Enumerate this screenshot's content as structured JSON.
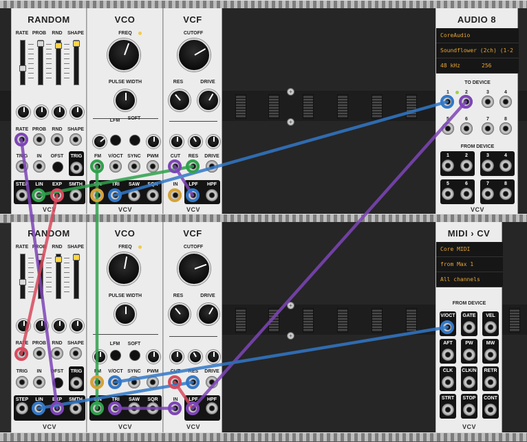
{
  "colors": {
    "cable_purple": "#7e45b8",
    "cable_green": "#2fa24c",
    "cable_red": "#d94a5d",
    "cable_blue": "#3278c8",
    "cable_yellow": "#d6a236",
    "accent_led": "#f2c94c"
  },
  "brand": "VCV",
  "random": {
    "title": "RANDOM",
    "top_labels": [
      "RATE",
      "PROB",
      "RND",
      "SHAPE"
    ],
    "knob_labels": [
      "RATE",
      "PROB",
      "RND",
      "SHAPE"
    ],
    "row2_labels": [
      "TRIG",
      "IN",
      "OFST",
      "TRIG"
    ],
    "out_labels": [
      "STEP",
      "LIN",
      "EXP",
      "SMTH"
    ]
  },
  "vco": {
    "title": "VCO",
    "freq": "FREQ",
    "pw": "PULSE WIDTH",
    "lfm": "LFM",
    "soft": "SOFT",
    "in_labels": [
      "FM",
      "V/OCT",
      "SYNC",
      "PWM"
    ],
    "out_labels": [
      "SIN",
      "TRI",
      "SAW",
      "SQR"
    ]
  },
  "vcf": {
    "title": "VCF",
    "cutoff": "CUTOFF",
    "res": "RES",
    "drive": "DRIVE",
    "in_labels": [
      "CUT",
      "RES",
      "DRIVE"
    ],
    "out_labels": [
      "IN",
      "LPF",
      "HPF"
    ]
  },
  "audio8": {
    "title": "AUDIO 8",
    "driver": "CoreAudio",
    "device": "Soundflower (2ch) (1-2",
    "rate": "48 kHz",
    "block": "256",
    "to_device": "TO DEVICE",
    "from_device": "FROM DEVICE",
    "ch": [
      "1",
      "2",
      "3",
      "4",
      "5",
      "6",
      "7",
      "8"
    ]
  },
  "midicv": {
    "title": "MIDI › CV",
    "driver": "Core MIDI",
    "device": "from Max 1",
    "channel": "All channels",
    "from_device": "FROM DEVICE",
    "outs": [
      "V/OCT",
      "GATE",
      "VEL",
      "AFT",
      "PW",
      "MW",
      "CLK",
      "CLK/N",
      "RETR",
      "STRT",
      "STOP",
      "CONT"
    ]
  }
}
